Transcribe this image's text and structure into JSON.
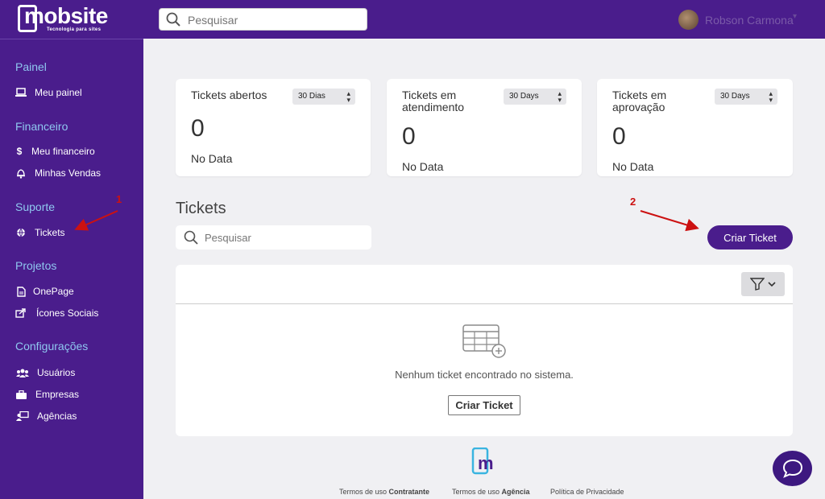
{
  "header": {
    "logo_text": "mobsite",
    "logo_subtitle": "Tecnologia para sites",
    "search_placeholder": "Pesquisar",
    "user_name": "Robson Carmona"
  },
  "sidebar": {
    "sections": [
      {
        "title": "Painel",
        "items": [
          {
            "label": "Meu painel",
            "icon": "laptop-icon"
          }
        ]
      },
      {
        "title": "Financeiro",
        "items": [
          {
            "label": "Meu financeiro",
            "icon": "dollar-icon"
          },
          {
            "label": "Minhas Vendas",
            "icon": "bell-icon"
          }
        ]
      },
      {
        "title": "Suporte",
        "items": [
          {
            "label": "Tickets",
            "icon": "globe-icon"
          }
        ]
      },
      {
        "title": "Projetos",
        "items": [
          {
            "label": "OnePage",
            "icon": "file-icon"
          },
          {
            "label": "Ícones Sociais",
            "icon": "share-icon"
          }
        ]
      },
      {
        "title": "Configurações",
        "items": [
          {
            "label": "Usuários",
            "icon": "users-icon"
          },
          {
            "label": "Empresas",
            "icon": "briefcase-icon"
          },
          {
            "label": "Agências",
            "icon": "agency-icon"
          }
        ]
      }
    ]
  },
  "cards": [
    {
      "title": "Tickets abertos",
      "period": "30 Dias",
      "value": "0",
      "nodata": "No Data"
    },
    {
      "title": "Tickets em atendimento",
      "period": "30 Days",
      "value": "0",
      "nodata": "No Data"
    },
    {
      "title": "Tickets em aprovação",
      "period": "30 Days",
      "value": "0",
      "nodata": "No Data"
    }
  ],
  "tickets": {
    "heading": "Tickets",
    "search_placeholder": "Pesquisar",
    "create_button": "Criar Ticket",
    "empty_message": "Nenhum ticket encontrado no sistema.",
    "empty_button": "Criar Ticket"
  },
  "footer": {
    "link1_prefix": "Termos de uso ",
    "link1_bold": "Contratante",
    "link2_prefix": "Termos de uso ",
    "link2_bold": "Agência",
    "link3": "Política de Privacidade"
  },
  "annotations": {
    "arrow1": "1",
    "arrow2": "2"
  },
  "colors": {
    "brand_purple": "#4a1d8c",
    "section_title": "#8fc8f0",
    "annotation_red": "#cc1111"
  }
}
